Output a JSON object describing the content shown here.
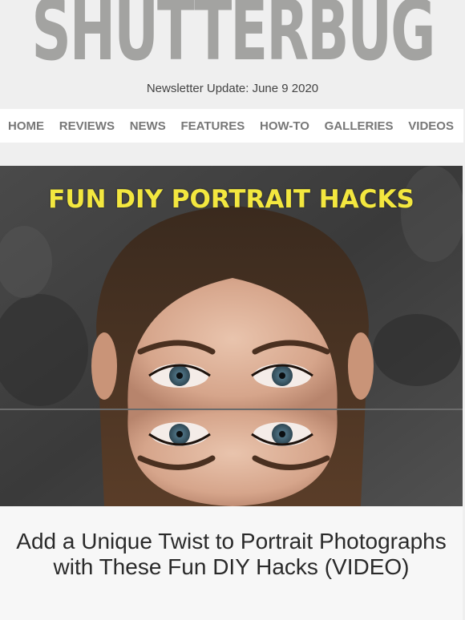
{
  "brand": {
    "logo_text": "SHUTTERBUG",
    "logo_color": "#a3a3a1"
  },
  "newsletter": {
    "date_line": "Newsletter Update: June 9 2020"
  },
  "nav": {
    "items": [
      {
        "label": "HOME"
      },
      {
        "label": "REVIEWS"
      },
      {
        "label": "NEWS"
      },
      {
        "label": "FEATURES"
      },
      {
        "label": "HOW-TO"
      },
      {
        "label": "GALLERIES"
      },
      {
        "label": "VIDEOS"
      }
    ]
  },
  "hero": {
    "caption": "FUN DIY PORTRAIT HACKS",
    "caption_color": "#f3e73f"
  },
  "article": {
    "title": "Add a Unique Twist to Portrait Photographs with These Fun DIY Hacks (VIDEO)"
  }
}
